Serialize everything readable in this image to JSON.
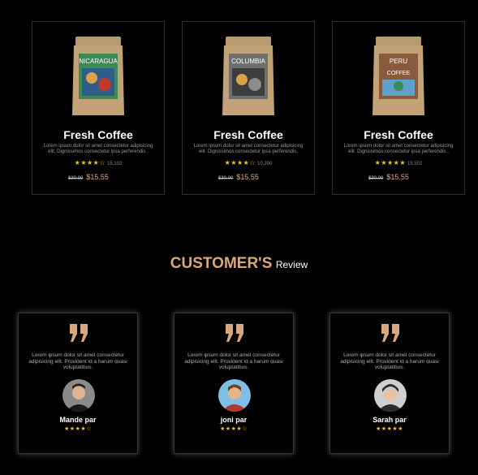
{
  "products": [
    {
      "title": "Fresh Coffee",
      "desc": "Lorem ipsum dolor sit amet consectetur adipisicing elit. Dignissimos consectetur ipsa perferendis ,",
      "stars": "★★★★☆",
      "count": "15,102",
      "old_price": "$30.00",
      "price": "$15.55",
      "origin": "NICARAGUA",
      "bag_color": "#3d8a55"
    },
    {
      "title": "Fresh Coffee",
      "desc": "Lorem ipsum dolor sit amet consectetur adipisicing elit. Dignissimos consectetur ipsa perferendis,",
      "stars": "★★★★☆",
      "count": "10,200",
      "old_price": "$30.00",
      "price": "$15.55",
      "origin": "COLUMBIA",
      "bag_color": "#6f6f6f"
    },
    {
      "title": "Fresh Coffee",
      "desc": "Lorem ipsum dolor sit amet consectetur adipisicing elit. Dignissimos consectetur ipsa perferendis ,",
      "stars": "★★★★★",
      "count": "15,502",
      "old_price": "$30.00",
      "price": "$15.55",
      "origin": "PERU",
      "bag_color": "#8a5a3c"
    }
  ],
  "section_heading": {
    "main": "CUSTOMER'S",
    "sub": "Review"
  },
  "reviews": [
    {
      "text": "Lorem ipsum dolor sit amet consectetur adipisicing elit. Provident id a harum quasi voluptatibus.",
      "name": "Mande par",
      "stars": "★★★★☆"
    },
    {
      "text": "Lorem ipsum dolor sit amet consectetur adipisicing elit. Provident id a harum quasi voluptatibus.",
      "name": "joni par",
      "stars": "★★★★☆"
    },
    {
      "text": "Lorem ipsum dolor sit amet consectetur adipisicing elit. Provident id a harum quasi voluptatibus.",
      "name": "Sarah par",
      "stars": "★★★★★"
    }
  ],
  "colors": {
    "accent": "#d9a97c",
    "price": "#e8a876",
    "star": "#f5c518",
    "background": "#000000"
  }
}
